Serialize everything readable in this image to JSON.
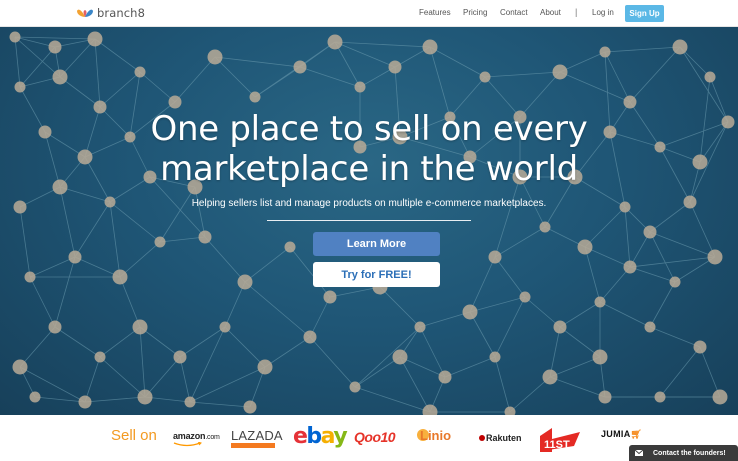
{
  "nav": {
    "brand": "branch8",
    "links": [
      "Features",
      "Pricing",
      "Contact",
      "About"
    ],
    "separator": "|",
    "login": "Log in",
    "signup": "Sign Up"
  },
  "hero": {
    "title_line1": "One place to sell on every",
    "title_line2": "marketplace in the world",
    "subtitle": "Helping sellers list and manage products on multiple e-commerce marketplaces.",
    "learn_more": "Learn More",
    "try_free": "Try for FREE!"
  },
  "marketplaces": {
    "label": "Sell on",
    "amazon": "amazon",
    "amazon_tld": ".com",
    "lazada": "LAZADA",
    "ebay": [
      "e",
      "b",
      "a",
      "y"
    ],
    "qoo10": "Qoo10",
    "linio": "Linio",
    "rakuten": "Rakuten",
    "eleven": "11ST",
    "jumia": "JUMIA"
  },
  "chat": {
    "label": "Contact the founders!"
  },
  "colors": {
    "accent": "#5bb8e6",
    "learn_button": "#5081c2",
    "try_text": "#2c6fb7",
    "sell_on": "#f39a21",
    "ebay": [
      "#e53238",
      "#0064d2",
      "#f5af02",
      "#86b817"
    ]
  }
}
